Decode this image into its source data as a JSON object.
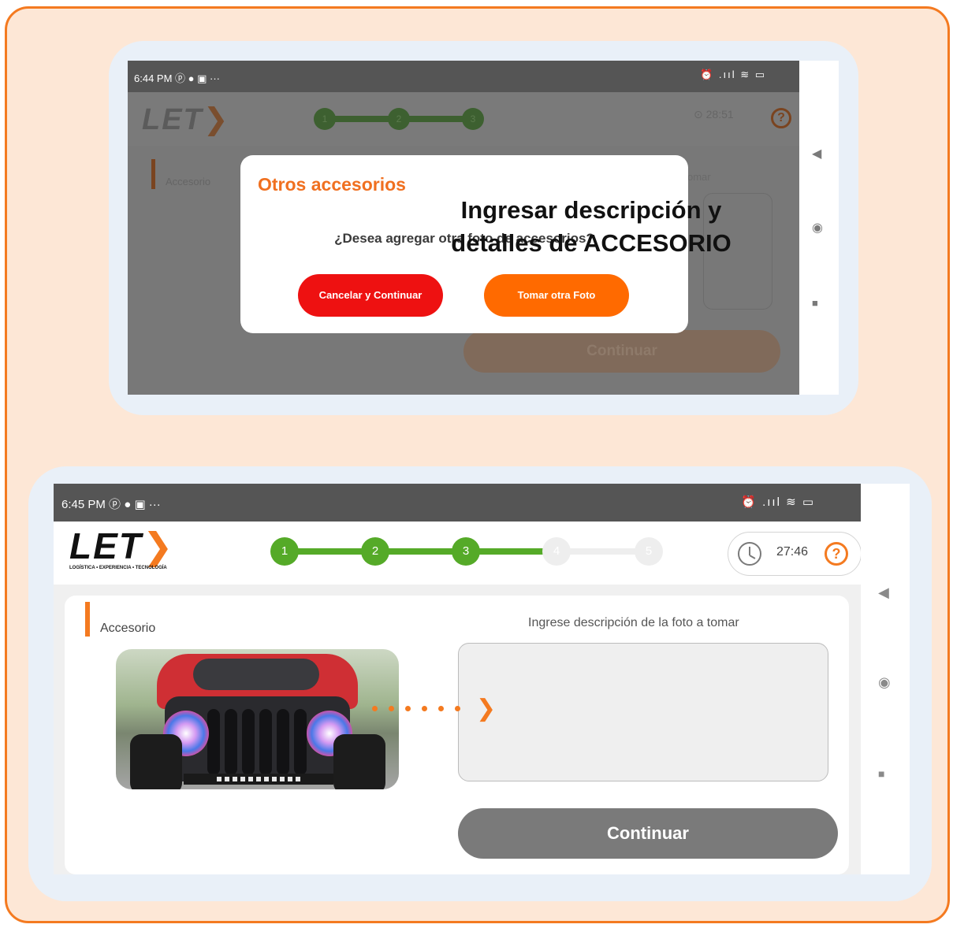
{
  "phone1": {
    "status_time": "6:44 PM",
    "status_icons": "ⓟ ● ▣ ···",
    "status_right": "⏰ .ııl ≋ ▭",
    "logo": "LET",
    "logo_chevron": "❯",
    "steps": [
      "1",
      "2",
      "3"
    ],
    "timer": "28:51",
    "help": "?",
    "field_label": "Accesorio",
    "field_hint_partial": "omar",
    "continue_label": "Continuar",
    "dialog": {
      "title": "Otros accesorios",
      "message": "¿Desea agregar otra foto de accesorios?",
      "cancel_label": "Cancelar y Continuar",
      "take_label": "Tomar otra Foto"
    },
    "nav": {
      "back": "◀",
      "home": "◉",
      "recent": "■"
    }
  },
  "phone2": {
    "status_time": "6:45 PM",
    "status_icons": "ⓟ ● ▣ ···",
    "status_right": "⏰ .ııl ≋ ▭",
    "logo": "LET",
    "logo_chevron": "❯",
    "logo_tagline": "LOGÍSTICA • EXPERIENCIA • TECNOLOGÍA",
    "steps": [
      "1",
      "2",
      "3",
      "4",
      "5"
    ],
    "timer": "27:46",
    "help": "?",
    "field_label": "Accesorio",
    "field_hint": "Ingrese descripción de la foto a tomar",
    "callout": "Ingresar descripción y detalles de ACCESORIO",
    "continue_label": "Continuar",
    "nav": {
      "back": "◀",
      "home": "◉",
      "recent": "■"
    }
  },
  "colors": {
    "accent": "#f47a20",
    "frame_bg": "#fde7d6",
    "step_done": "#55aa28",
    "step_pending": "#eeeeee",
    "cancel": "#ee1111",
    "take": "#ff6a00"
  }
}
